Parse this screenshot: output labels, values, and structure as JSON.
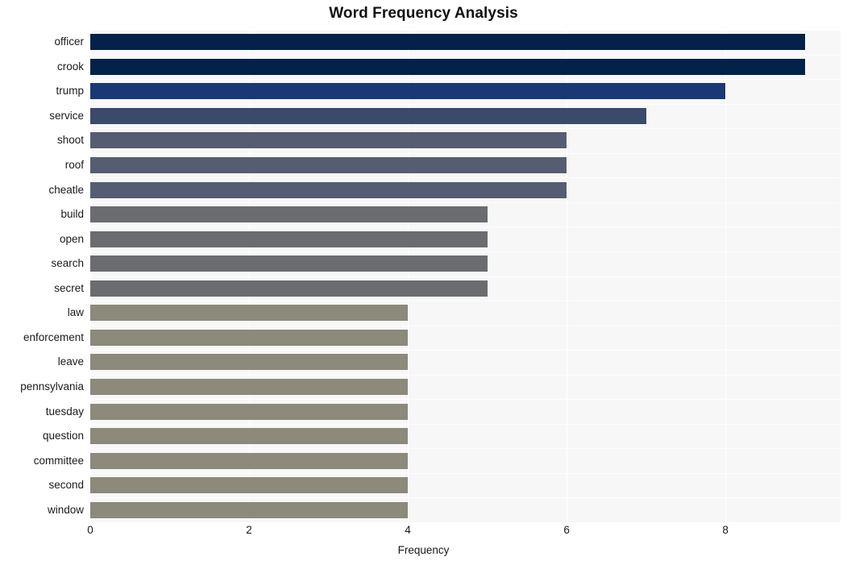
{
  "chart_data": {
    "type": "bar",
    "orientation": "horizontal",
    "title": "Word Frequency Analysis",
    "xlabel": "Frequency",
    "ylabel": "",
    "categories": [
      "officer",
      "crook",
      "trump",
      "service",
      "shoot",
      "roof",
      "cheatle",
      "build",
      "open",
      "search",
      "secret",
      "law",
      "enforcement",
      "leave",
      "pennsylvania",
      "tuesday",
      "question",
      "committee",
      "second",
      "window"
    ],
    "values": [
      9,
      9,
      8,
      7,
      6,
      6,
      6,
      5,
      5,
      5,
      5,
      4,
      4,
      4,
      4,
      4,
      4,
      4,
      4,
      4
    ],
    "bar_colors": [
      "#042149",
      "#042149",
      "#1a3876",
      "#3a4a6b",
      "#565d72",
      "#565d72",
      "#565d72",
      "#6b6c70",
      "#6b6c70",
      "#6b6c70",
      "#6b6c70",
      "#8b8a7b",
      "#8b8a7b",
      "#8b8a7b",
      "#8b8a7b",
      "#8b8a7b",
      "#8b8a7b",
      "#8b8a7b",
      "#8b8a7b",
      "#8b8a7b"
    ],
    "xticks": [
      0,
      2,
      4,
      6,
      8
    ],
    "xtick_labels": [
      "0",
      "2",
      "4",
      "6",
      "8"
    ],
    "xlim": [
      0,
      9.45
    ],
    "grid": true,
    "legend": "none",
    "plot_background": "#f7f7f7",
    "figure_background": "#ffffff",
    "gridline_color": "#ffffff"
  }
}
